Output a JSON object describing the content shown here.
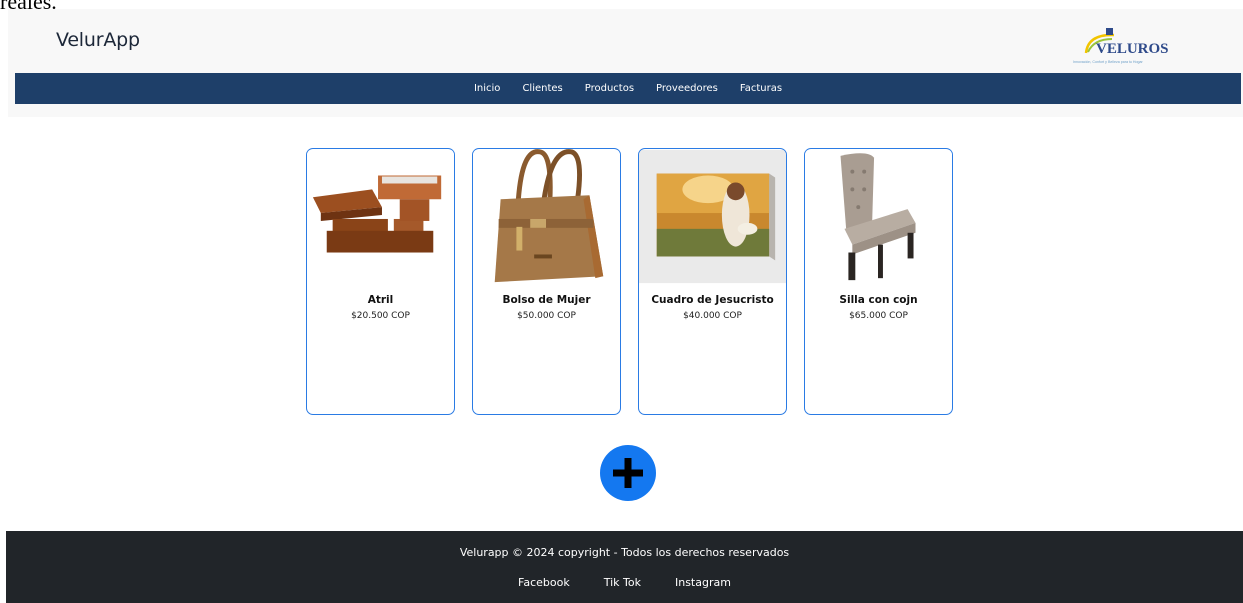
{
  "doc_fragment": "reales.",
  "header": {
    "brand": "VelurApp",
    "logo": {
      "name": "VELUROS",
      "tagline": "Innovación, Confort y Belleza para tu Hogar"
    }
  },
  "nav": {
    "items": [
      {
        "label": "Inicio"
      },
      {
        "label": "Clientes"
      },
      {
        "label": "Productos"
      },
      {
        "label": "Proveedores"
      },
      {
        "label": "Facturas"
      }
    ]
  },
  "products": [
    {
      "name": "Atril",
      "price": "$20.500 COP",
      "image": "wooden-table-image"
    },
    {
      "name": "Bolso de Mujer",
      "price": "$50.000 COP",
      "image": "leather-handbag-image"
    },
    {
      "name": "Cuadro de Jesucristo",
      "price": "$40.000 COP",
      "image": "jesus-painting-image"
    },
    {
      "name": "Silla con cojn",
      "price": "$65.000 COP",
      "image": "upholstered-chair-image"
    }
  ],
  "add_button": {
    "icon": "plus-icon"
  },
  "footer": {
    "copyright": "Velurapp © 2024 copyright - Todos los derechos reservados",
    "links": [
      {
        "label": "Facebook"
      },
      {
        "label": "Tik Tok"
      },
      {
        "label": "Instagram"
      }
    ]
  },
  "colors": {
    "nav_bg": "#1e3f69",
    "card_border": "#2a7be4",
    "accent": "#1478f0",
    "footer_bg": "#212529"
  }
}
